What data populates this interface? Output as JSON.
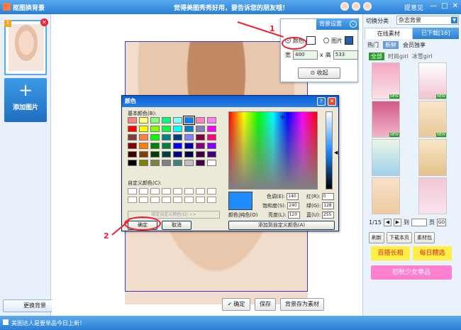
{
  "window": {
    "title": "抠图换背景",
    "slogan": "觉得美图秀秀好用，要告诉您的朋友哦！",
    "feedback": "提意见",
    "min": "—",
    "max": "□",
    "close": "✕"
  },
  "left_panel": {
    "thumb_index": "1",
    "delete_glyph": "✕",
    "add_plus": "+",
    "add_label": "添加图片",
    "change_bg": "更换背景"
  },
  "right_panel": {
    "switch_label": "切换分类",
    "category_value": "杂志背景",
    "tab_online": "在线素材",
    "tab_downloaded": "已下载[16]",
    "sub_tabs": [
      "热门",
      "新鲜",
      "会员独享"
    ],
    "filter_tabs": [
      "全部",
      "时尚girl",
      "冰雪girl"
    ],
    "new_badge": "NEW",
    "page_label": "1/15",
    "prev_glyph": "◀",
    "next_glyph": "▶",
    "to_label": "到",
    "page_unit": "页",
    "go_label": "GO",
    "refresh": "刷新",
    "download_page": "下载本页",
    "library": "素材包",
    "promo_1": "百搭长相",
    "promo_2": "每日精选",
    "promo_3": "初秋少女单品"
  },
  "bg_settings": {
    "header": "背景设置",
    "collapse_glyph": "⌄",
    "option_color": "颜色",
    "option_image": "图片",
    "width_label": "宽",
    "width_value": "400",
    "times": "x",
    "height_label": "高",
    "height_value": "533",
    "collapse_btn": "收起"
  },
  "color_dialog": {
    "title": "颜色",
    "help": "?",
    "close": "✕",
    "basic_label": "基本颜色(B):",
    "custom_label": "自定义颜色(C):",
    "define_btn": "规定自定义颜色(D) >>",
    "ok": "确定",
    "cancel": "取消",
    "preview_label": "颜色|纯色(O)",
    "add_custom": "添加到自定义颜色(A)",
    "hue_label": "色调(E):",
    "hue_value": "140",
    "sat_label": "饱和度(S):",
    "sat_value": "240",
    "lum_label": "亮度(L):",
    "lum_value": "120",
    "red_label": "红(R):",
    "red_value": "0",
    "green_label": "绿(G):",
    "green_value": "128",
    "blue_label": "蓝(U):",
    "blue_value": "255",
    "basic_colors": [
      "#ff8080",
      "#ffff80",
      "#80ff80",
      "#00ff80",
      "#80ffff",
      "#0080ff",
      "#ff80c0",
      "#ff80ff",
      "#ff0000",
      "#ffff00",
      "#80ff00",
      "#00ff40",
      "#00ffff",
      "#0080c0",
      "#8080c0",
      "#ff00ff",
      "#804040",
      "#ff8040",
      "#00ff00",
      "#008080",
      "#004080",
      "#8080ff",
      "#800040",
      "#ff0080",
      "#800000",
      "#ff8000",
      "#008000",
      "#008040",
      "#0000ff",
      "#0000a0",
      "#800080",
      "#8000ff",
      "#400000",
      "#804000",
      "#004000",
      "#004040",
      "#000080",
      "#000040",
      "#400040",
      "#400080",
      "#000000",
      "#808000",
      "#808040",
      "#808080",
      "#408080",
      "#c0c0c0",
      "#400040",
      "#ffffff"
    ]
  },
  "bottom": {
    "ok_check": "✔",
    "ok": "确定",
    "save": "保存",
    "save_as_material": "背景存为素材"
  },
  "statusbar": {
    "text": "美图达人是要单品今日上新！"
  },
  "annotations": {
    "num1": "1",
    "num2": "2"
  }
}
